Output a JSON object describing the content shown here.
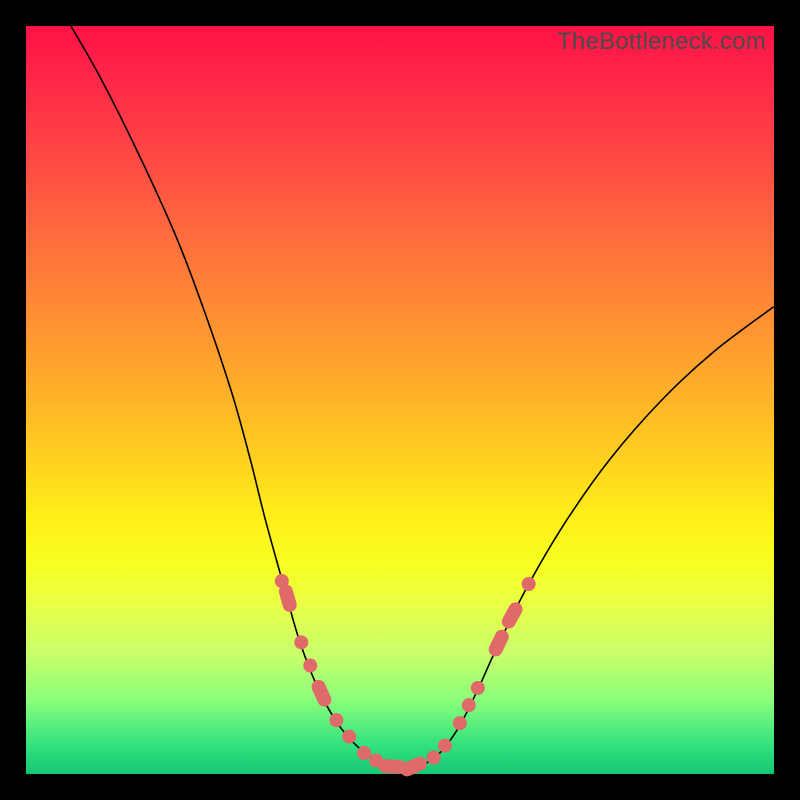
{
  "watermark": "TheBottleneck.com",
  "colors": {
    "background": "#000000",
    "curve": "#000000",
    "marker": "#e06a6a"
  },
  "chart_data": {
    "type": "line",
    "title": "",
    "xlabel": "",
    "ylabel": "",
    "xlim": [
      0,
      1
    ],
    "ylim": [
      0,
      1
    ],
    "curve_points": [
      {
        "x": 0.06,
        "y": 1.0
      },
      {
        "x": 0.1,
        "y": 0.93
      },
      {
        "x": 0.15,
        "y": 0.83
      },
      {
        "x": 0.2,
        "y": 0.72
      },
      {
        "x": 0.238,
        "y": 0.62
      },
      {
        "x": 0.275,
        "y": 0.51
      },
      {
        "x": 0.3,
        "y": 0.42
      },
      {
        "x": 0.32,
        "y": 0.34
      },
      {
        "x": 0.345,
        "y": 0.25
      },
      {
        "x": 0.365,
        "y": 0.18
      },
      {
        "x": 0.388,
        "y": 0.12
      },
      {
        "x": 0.415,
        "y": 0.07
      },
      {
        "x": 0.445,
        "y": 0.035
      },
      {
        "x": 0.475,
        "y": 0.015
      },
      {
        "x": 0.505,
        "y": 0.008
      },
      {
        "x": 0.53,
        "y": 0.012
      },
      {
        "x": 0.555,
        "y": 0.03
      },
      {
        "x": 0.58,
        "y": 0.065
      },
      {
        "x": 0.605,
        "y": 0.115
      },
      {
        "x": 0.63,
        "y": 0.17
      },
      {
        "x": 0.67,
        "y": 0.25
      },
      {
        "x": 0.72,
        "y": 0.335
      },
      {
        "x": 0.78,
        "y": 0.42
      },
      {
        "x": 0.85,
        "y": 0.5
      },
      {
        "x": 0.92,
        "y": 0.565
      },
      {
        "x": 1.0,
        "y": 0.625
      }
    ],
    "markers": [
      {
        "x": 0.342,
        "y": 0.258,
        "shape": "circle"
      },
      {
        "x": 0.35,
        "y": 0.235,
        "shape": "pill"
      },
      {
        "x": 0.368,
        "y": 0.176,
        "shape": "circle"
      },
      {
        "x": 0.38,
        "y": 0.145,
        "shape": "circle"
      },
      {
        "x": 0.395,
        "y": 0.108,
        "shape": "pill"
      },
      {
        "x": 0.415,
        "y": 0.072,
        "shape": "circle"
      },
      {
        "x": 0.432,
        "y": 0.05,
        "shape": "circle"
      },
      {
        "x": 0.452,
        "y": 0.028,
        "shape": "circle"
      },
      {
        "x": 0.468,
        "y": 0.018,
        "shape": "circle"
      },
      {
        "x": 0.49,
        "y": 0.01,
        "shape": "pill"
      },
      {
        "x": 0.518,
        "y": 0.01,
        "shape": "pill"
      },
      {
        "x": 0.545,
        "y": 0.022,
        "shape": "circle"
      },
      {
        "x": 0.56,
        "y": 0.038,
        "shape": "circle"
      },
      {
        "x": 0.58,
        "y": 0.068,
        "shape": "circle"
      },
      {
        "x": 0.592,
        "y": 0.092,
        "shape": "circle"
      },
      {
        "x": 0.604,
        "y": 0.115,
        "shape": "circle"
      },
      {
        "x": 0.632,
        "y": 0.175,
        "shape": "pill"
      },
      {
        "x": 0.65,
        "y": 0.212,
        "shape": "pill"
      },
      {
        "x": 0.672,
        "y": 0.254,
        "shape": "circle"
      }
    ]
  }
}
